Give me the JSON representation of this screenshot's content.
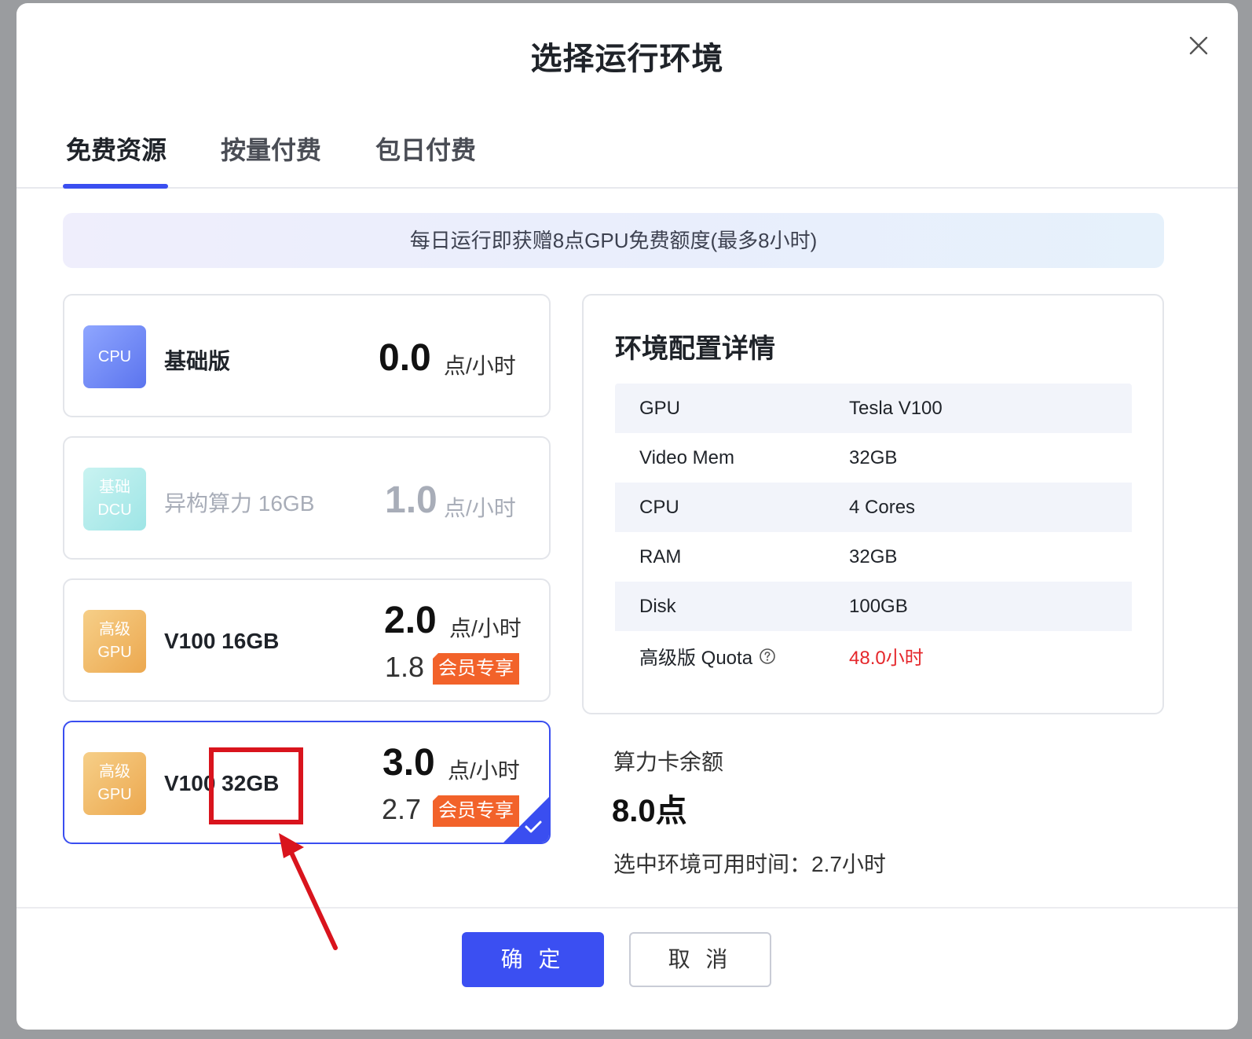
{
  "modal": {
    "title": "选择运行环境"
  },
  "tabs": [
    {
      "label": "免费资源",
      "active": true
    },
    {
      "label": "按量付费",
      "active": false
    },
    {
      "label": "包日付费",
      "active": false
    }
  ],
  "banner": "每日运行即获赠8点GPU免费额度(最多8小时)",
  "cards": [
    {
      "icon_lines": [
        "CPU"
      ],
      "name": "基础版",
      "price": "0.0",
      "unit": "点/小时",
      "state": "normal"
    },
    {
      "icon_lines": [
        "基础",
        "DCU"
      ],
      "name": "异构算力 16GB",
      "price": "1.0",
      "unit": "点/小时",
      "state": "disabled"
    },
    {
      "icon_lines": [
        "高级",
        "GPU"
      ],
      "name": "V100 16GB",
      "price": "2.0",
      "unit": "点/小时",
      "member_price": "1.8",
      "member_badge": "会员专享",
      "state": "normal"
    },
    {
      "icon_lines": [
        "高级",
        "GPU"
      ],
      "name": "V100 32GB",
      "price": "3.0",
      "unit": "点/小时",
      "member_price": "2.7",
      "member_badge": "会员专享",
      "state": "selected"
    }
  ],
  "details": {
    "title": "环境配置详情",
    "rows": [
      {
        "key": "GPU",
        "value": "Tesla V100"
      },
      {
        "key": "Video Mem",
        "value": "32GB"
      },
      {
        "key": "CPU",
        "value": "4 Cores"
      },
      {
        "key": "RAM",
        "value": "32GB"
      },
      {
        "key": "Disk",
        "value": "100GB"
      },
      {
        "key": "高级版 Quota",
        "value": "48.0小时",
        "help_icon": true,
        "highlight": "#e5272b"
      }
    ]
  },
  "balance": {
    "label": "算力卡余额",
    "value": "8.0点",
    "available": "选中环境可用时间：2.7小时"
  },
  "buttons": {
    "confirm": "确 定",
    "cancel": "取 消"
  },
  "colors": {
    "accent": "#3a4ef0",
    "member_badge": "#f2622a",
    "annotation": "#d9141d"
  }
}
